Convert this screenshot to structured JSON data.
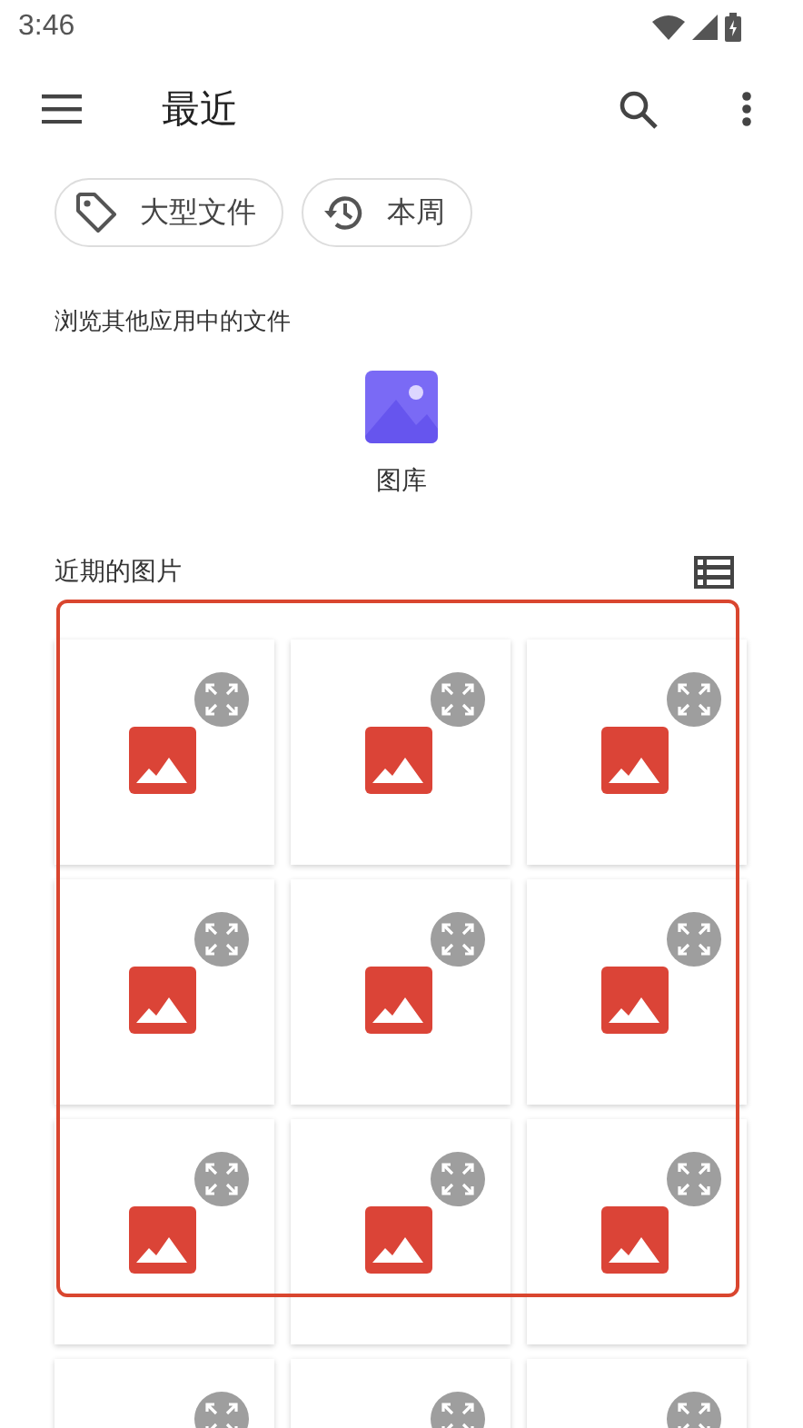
{
  "status_bar": {
    "time": "3:46"
  },
  "toolbar": {
    "title": "最近"
  },
  "chips": [
    {
      "kind": "tag",
      "label": "大型文件"
    },
    {
      "kind": "history",
      "label": "本周"
    }
  ],
  "browse": {
    "heading": "浏览其他应用中的文件",
    "apps": [
      {
        "label": "图库"
      }
    ]
  },
  "recent": {
    "heading": "近期的图片",
    "thumbnails": [
      {
        "kind": "image"
      },
      {
        "kind": "image"
      },
      {
        "kind": "image"
      },
      {
        "kind": "image"
      },
      {
        "kind": "image"
      },
      {
        "kind": "image"
      },
      {
        "kind": "image"
      },
      {
        "kind": "image"
      },
      {
        "kind": "image"
      },
      {
        "kind": "cut_off"
      },
      {
        "kind": "cut_off"
      },
      {
        "kind": "cut_off"
      }
    ]
  }
}
